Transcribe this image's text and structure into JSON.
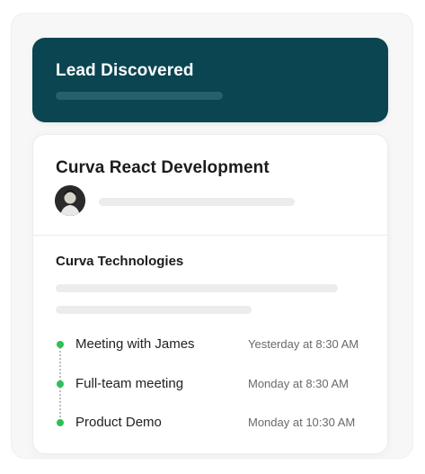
{
  "lead_banner": {
    "title": "Lead Discovered"
  },
  "card": {
    "title": "Curva React Development",
    "company": "Curva Technologies",
    "events": [
      {
        "name": "Meeting with James",
        "time": "Yesterday at 8:30 AM"
      },
      {
        "name": "Full-team meeting",
        "time": "Monday at 8:30 AM"
      },
      {
        "name": "Product Demo",
        "time": "Monday at 10:30 AM"
      }
    ]
  },
  "colors": {
    "banner_bg": "#0b4552",
    "accent_green": "#2fbf5a",
    "placeholder_bar": "#ececec"
  }
}
